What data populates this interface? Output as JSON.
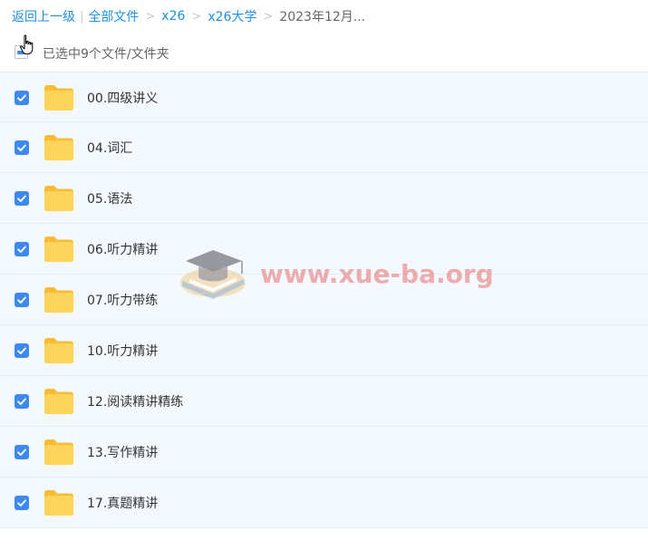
{
  "breadcrumb": {
    "back": "返回上一级",
    "separator_bar": "|",
    "root": "全部文件",
    "separator": ">",
    "level1": "x26",
    "level2": "x26大学",
    "current": "2023年12月..."
  },
  "selection": {
    "count_text": "已选中9个文件/文件夹"
  },
  "files": [
    {
      "name": "00.四级讲义",
      "checked": true
    },
    {
      "name": "04.词汇",
      "checked": true
    },
    {
      "name": "05.语法",
      "checked": true
    },
    {
      "name": "06.听力精讲",
      "checked": true
    },
    {
      "name": "07.听力带练",
      "checked": true
    },
    {
      "name": "10.听力精讲",
      "checked": true
    },
    {
      "name": "12.阅读精讲精练",
      "checked": true
    },
    {
      "name": "13.写作精讲",
      "checked": true
    },
    {
      "name": "17.真题精讲",
      "checked": true
    }
  ],
  "watermark": {
    "text": "www.xue-ba.org"
  },
  "colors": {
    "link": "#1f8fe3",
    "checkbox": "#3f89ec",
    "row_bg": "#f3f9fe",
    "folder": "#fcc94a"
  },
  "icons": {
    "folder": "folder-icon",
    "checkbox": "checkbox-checked-icon",
    "cursor": "hand-pointer-icon",
    "logo": "graduation-cap-icon"
  }
}
